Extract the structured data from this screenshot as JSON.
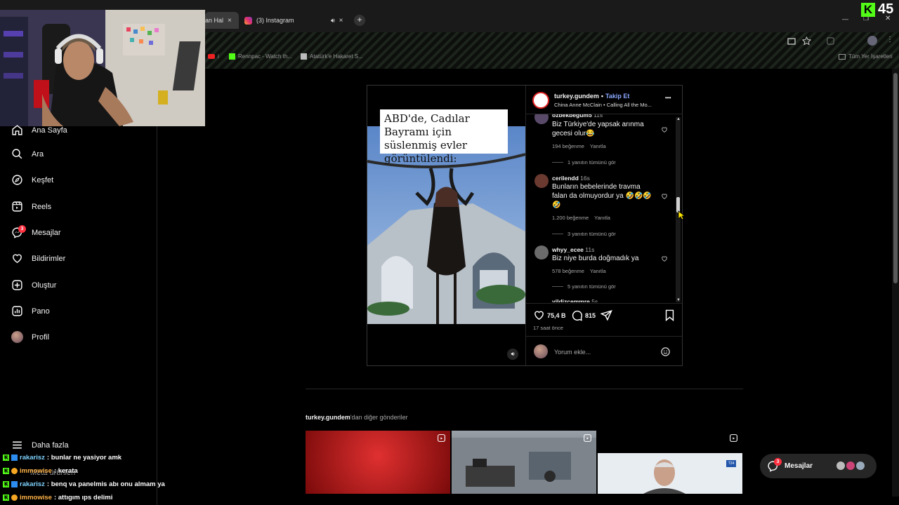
{
  "browser": {
    "tabs": [
      {
        "label": "an Hal",
        "close": "×"
      },
      {
        "label": "(3) Instagram",
        "close": "×"
      }
    ],
    "new_tab": "+",
    "bookmarks": [
      {
        "label": "i"
      },
      {
        "label": "Rennpac - Watch th..."
      },
      {
        "label": "Atatürk'e Hakaret S..."
      }
    ],
    "bookmarks_folder": "Tüm Yer İşaretleri",
    "window_controls": {
      "minimize": "—",
      "maximize": "❐",
      "close": "✕"
    }
  },
  "overlay": {
    "kick_count": "45",
    "kick_logo": "K"
  },
  "sidebar": {
    "items": [
      {
        "label": "Ana Sayfa",
        "icon": "home-icon"
      },
      {
        "label": "Ara",
        "icon": "search-icon"
      },
      {
        "label": "Keşfet",
        "icon": "compass-icon"
      },
      {
        "label": "Reels",
        "icon": "reels-icon"
      },
      {
        "label": "Mesajlar",
        "icon": "messenger-icon",
        "badge": "3"
      },
      {
        "label": "Bildirimler",
        "icon": "heart-icon"
      },
      {
        "label": "Oluştur",
        "icon": "plus-square-icon"
      },
      {
        "label": "Pano",
        "icon": "dashboard-icon"
      },
      {
        "label": "Profil",
        "icon": "avatar"
      }
    ],
    "more": "Daha fazla",
    "more_below": "Meta ürünleri"
  },
  "post": {
    "caption_image": "ABD'de, Cadılar Bayramı için süslenmiş evler görüntülendi:",
    "author": "turkey.gundem",
    "separator": "•",
    "follow": "Takip Et",
    "audio": "China Anne McClain • Calling All the Mo...",
    "options": "•••",
    "comments": [
      {
        "user": "ozbekbegum5",
        "time": "11s",
        "text": "Biz Türkiye'de yapsak arınma gecesi olur😂",
        "likes": "194 beğenme",
        "reply": "Yanıtla",
        "more": "1 yanıtın tümünü gör"
      },
      {
        "user": "cerilendd",
        "time": "16s",
        "text": "Bunların bebelerinde travma falan da olmuyordur ya 🤣🤣🤣🤣",
        "likes": "1.200 beğenme",
        "reply": "Yanıtla",
        "more": "3 yanıtın tümünü gör"
      },
      {
        "user": "whyy_ecee",
        "time": "11s",
        "text": "Biz niye burda doğmadık ya",
        "likes": "578 beğenme",
        "reply": "Yanıtla",
        "more": "5 yanıtın tümünü gör"
      },
      {
        "user": "yildizcemmre",
        "time": "5s"
      }
    ],
    "like_count": "75,4 B",
    "comment_count": "815",
    "posted": "17 saat önce",
    "comment_placeholder": "Yorum ekle...",
    "scroll_fraction": 0.47
  },
  "more_posts": {
    "author": "turkey.gundem",
    "suffix": "'dan diğer gönderiler"
  },
  "messages_pill": {
    "label": "Mesajlar",
    "badge": "3"
  },
  "chat": [
    {
      "user": "rakarisz",
      "text": ": bunlar ne yasiyor amk",
      "color": "#7fd4ff"
    },
    {
      "user": "immowise",
      "text": ": kerata",
      "color": "#ffb347"
    },
    {
      "user": "rakarisz",
      "text": ": benq va panelmis abı onu almam ya",
      "color": "#7fd4ff"
    },
    {
      "user": "immowise",
      "text": ": attıgım ıps delimi",
      "color": "#ffb347"
    }
  ],
  "colors": {
    "accent": "#0095f6",
    "follow": "#8aa8ff",
    "kick_green": "#53fc18",
    "badge_red": "#ff3040"
  }
}
